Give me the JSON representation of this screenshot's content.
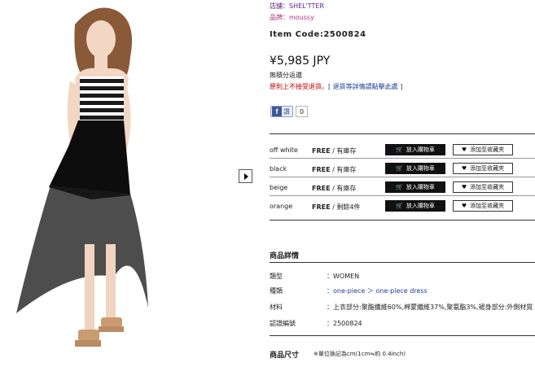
{
  "photo": {
    "alt": ""
  },
  "slide_next": {
    "label": ""
  },
  "shop": {
    "text": "店舖：SHEL'TTER"
  },
  "brand": {
    "text": "品牌：moussy"
  },
  "item_code": {
    "text": "Item Code:2500824"
  },
  "price": {
    "text": "¥5,985 JPY"
  },
  "notes": {
    "line1": "無積分返還",
    "line2_red": "原則上不接受退貨。",
    "line2_blue": "[ 退貨等詳情請點擊此處 ]"
  },
  "facebook": {
    "icon": "f",
    "label": "讚",
    "count": "0"
  },
  "variants": [
    {
      "color": "off white",
      "size": "FREE",
      "stock": " / 有庫存",
      "cart_label": "放入購物車",
      "fav_label": "添加至收藏夾"
    },
    {
      "color": "black",
      "size": "FREE",
      "stock": " / 有庫存",
      "cart_label": "放入購物車",
      "fav_label": "添加至收藏夾"
    },
    {
      "color": "beige",
      "size": "FREE",
      "stock": " / 有庫存",
      "cart_label": "放入購物車",
      "fav_label": "添加至收藏夾"
    },
    {
      "color": "orange",
      "size": "FREE",
      "stock": " / 剩餘4件",
      "cart_label": "放入購物車",
      "fav_label": "添加至收藏夾"
    }
  ],
  "details": {
    "title": "商品詳情",
    "rows": [
      {
        "key": "類型",
        "value": "：WOMEN"
      },
      {
        "key": "種類",
        "value": "：one-piece ＞ one-piece dress"
      },
      {
        "key": "材料",
        "value": "：上衣部分:聚酯纖維60%,棉蒙纖維37%,聚氨酯3%,裙身部分:外側材質"
      },
      {
        "key": "認證編號",
        "value": "：2500824"
      }
    ]
  },
  "size_section": {
    "title": "商品尺寸",
    "note": "※單位換記為cm(1cm≒約 0.4inch)"
  },
  "colors": {
    "accent_black": "#111111",
    "link_blue": "#1a3a9a",
    "warn_red": "#c00000",
    "shop_purple": "#5a1e8a"
  }
}
